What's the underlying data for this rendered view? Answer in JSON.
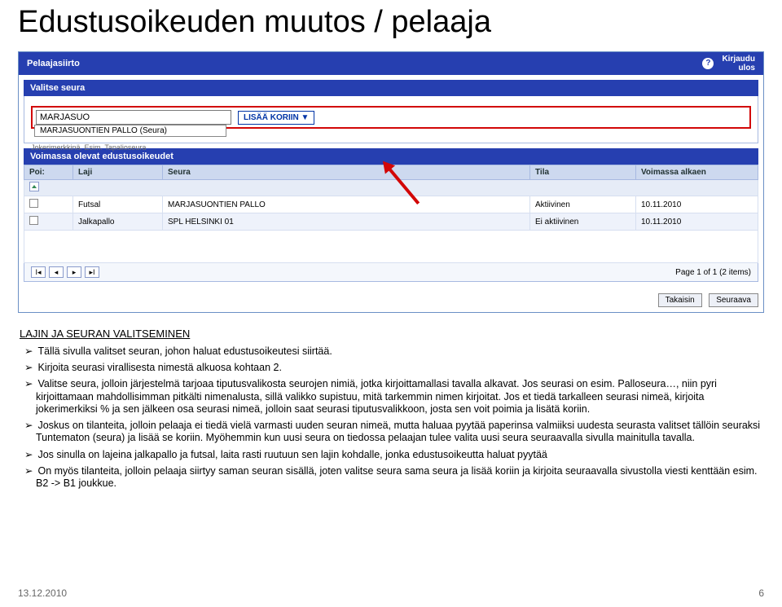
{
  "slide_title": "Edustusoikeuden muutos / pelaaja",
  "topbar": {
    "left": "Pelaajasiirto",
    "logout1": "Kirjaudu",
    "logout2": "ulos"
  },
  "panel_select": {
    "header": "Valitse seura",
    "search_value": "MARJASUO",
    "button": "LISÄÄ KORIIN ▼",
    "dropdown": "MARJASUONTIEN PALLO (Seura)",
    "hint": "Jokerimerkkinä. Esim. Tapalioseura"
  },
  "panel_rights": {
    "header": "Voimassa olevat edustusoikeudet",
    "columns": {
      "poi": "Poi:",
      "laji": "Laji",
      "seura": "Seura",
      "tila": "Tila",
      "alkaen": "Voimassa alkaen"
    },
    "rows": [
      {
        "laji": "Futsal",
        "seura": "MARJASUONTIEN PALLO",
        "tila": "Aktiivinen",
        "alkaen": "10.11.2010"
      },
      {
        "laji": "Jalkapallo",
        "seura": "SPL HELSINKI 01",
        "tila": "Ei aktiivinen",
        "alkaen": "10.11.2010"
      }
    ],
    "page_info": "Page 1 of 1 (2 items)"
  },
  "nav": {
    "back": "Takaisin",
    "next": "Seuraava"
  },
  "section_title": "LAJIN JA SEURAN VALITSEMINEN",
  "bullets": [
    "Tällä sivulla valitset seuran, johon haluat edustusoikeutesi siirtää.",
    "Kirjoita seurasi virallisesta nimestä alkuosa kohtaan 2.",
    "Valitse seura, jolloin järjestelmä tarjoaa tiputusvalikosta seurojen nimiä, jotka kirjoittamallasi tavalla alkavat. Jos seurasi on esim. Palloseura…, niin pyri kirjoittamaan mahdollisimman pitkälti nimenalusta, sillä valikko supistuu, mitä tarkemmin nimen kirjoitat. Jos et tiedä tarkalleen seurasi nimeä, kirjoita jokerimerkiksi % ja sen jälkeen osa seurasi nimeä, jolloin saat seurasi tiputusvalikkoon, josta sen voit poimia ja lisätä koriin.",
    "Joskus on tilanteita, jolloin pelaaja ei tiedä vielä varmasti uuden seuran nimeä, mutta haluaa pyytää paperinsa valmiiksi uudesta seurasta valitset tällöin seuraksi Tuntematon (seura) ja lisää se koriin. Myöhemmin kun uusi seura on tiedossa pelaajan tulee valita uusi seura seuraavalla sivulla mainitulla tavalla.",
    "Jos sinulla on lajeina jalkapallo ja futsal, laita rasti ruutuun sen lajin kohdalle, jonka edustusoikeutta haluat pyytää",
    "On myös tilanteita, jolloin pelaaja siirtyy saman seuran sisällä, joten valitse seura sama seura ja lisää koriin ja kirjoita seuraavalla sivustolla viesti kenttään esim. B2 -> B1 joukkue."
  ],
  "footer": {
    "date": "13.12.2010",
    "page": "6"
  }
}
